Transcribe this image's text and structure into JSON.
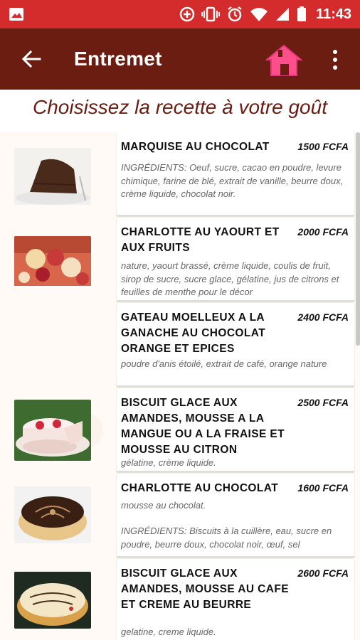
{
  "status_bar": {
    "time": "11:43"
  },
  "app_bar": {
    "title": "Entremet"
  },
  "subtitle": "Choisissez la recette à votre goût",
  "colors": {
    "status": "#d42c2c",
    "app_bar": "#6b1d12",
    "home_icon": "#ff4f8b"
  },
  "items": [
    {
      "name": "MARQUISE AU CHOCOLAT",
      "price": "1500 FCFA",
      "description": "INGRÉDIENTS: Oeuf, sucre, cacao en poudre, levure chimique, farine de blé, extrait de vanille, beurre doux, crème liquide, chocolat noir."
    },
    {
      "name": "CHARLOTTE AU YAOURT ET AUX FRUITS",
      "price": "2000 FCFA",
      "description": "nature, yaourt brassé, crème liquide, coulis de fruit, sirop de sucre, sucre glace, gélatine, jus de citrons et feuilles de menthe pour le décor"
    },
    {
      "name": "GATEAU MOELLEUX A LA GANACHE AU CHOCOLAT ORANGE ET EPICES",
      "price": "2400 FCFA",
      "description": "poudre d'anis étoilé, extrait de café, orange nature"
    },
    {
      "name": "BISCUIT GLACE AUX AMANDES, MOUSSE A LA MANGUE OU A LA FRAISE ET MOUSSE AU CITRON",
      "price": "2500 FCFA",
      "description": "gélatine, crème liquide."
    },
    {
      "name": "CHARLOTTE AU CHOCOLAT",
      "price": "1600 FCFA",
      "description": "mousse au chocolat.",
      "description2": "INGRÉDIENTS: Biscuits à la cuillère, eau, sucre en poudre, beurre doux, chocolat noir, œuf, sel"
    },
    {
      "name": "BISCUIT GLACE AUX AMANDES, MOUSSE AU CAFE ET CREME AU BEURRE",
      "price": "2600 FCFA",
      "description": "gelatine, creme liquide."
    }
  ]
}
